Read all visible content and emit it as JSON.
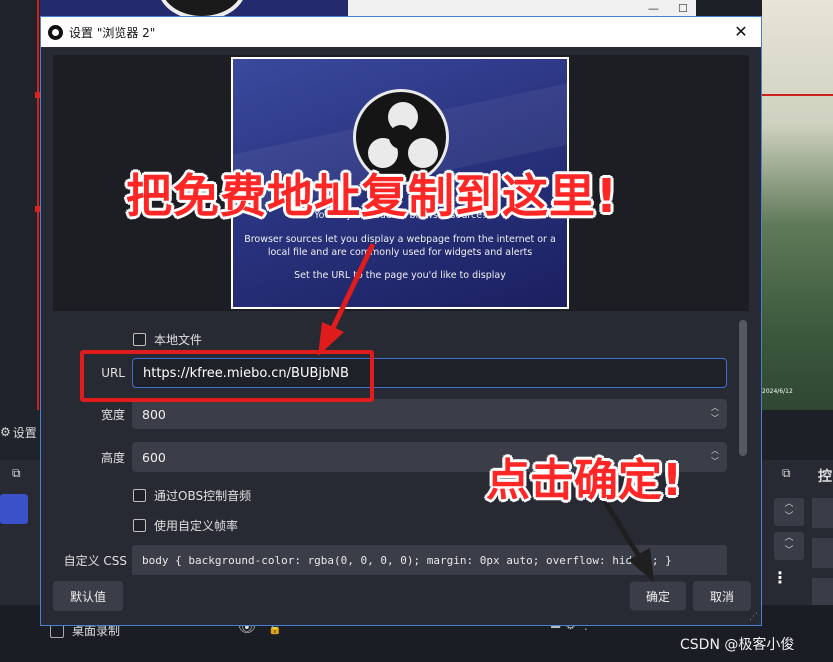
{
  "dialog": {
    "title": "设置 \"浏览器 2\"",
    "close_glyph": "✕"
  },
  "preview": {
    "line1": "You've just added a browser source!",
    "line2a": "Browser sources let you display a webpage from the internet or a",
    "line2b": "local file and are commonly used for widgets and alerts",
    "line3": "Set the URL to the page you'd like to display"
  },
  "form": {
    "local_file_label": "本地文件",
    "url_label": "URL",
    "url_value": "https://kfree.miebo.cn/BUBjbNB",
    "width_label": "宽度",
    "width_value": "800",
    "height_label": "高度",
    "height_value": "600",
    "obs_audio_label": "通过OBS控制音频",
    "custom_fps_label": "使用自定义帧率",
    "css_label": "自定义 CSS",
    "css_value": "body { background-color: rgba(0, 0, 0, 0); margin: 0px auto; overflow: hidden; }"
  },
  "buttons": {
    "defaults": "默认值",
    "ok": "确定",
    "cancel": "取消"
  },
  "annotations": {
    "copy_here": "把免费地址复制到这里!",
    "click_ok": "点击确定!"
  },
  "background": {
    "settings_label": "设置",
    "source_item": "桌面录制",
    "dock_right_label": "控",
    "date": "2024/6/12"
  },
  "watermark": "CSDN @极客小俊",
  "colors": {
    "accent_border": "#3f6fd1",
    "annotation_red": "#ff2626",
    "dialog_bg": "#272a33"
  }
}
